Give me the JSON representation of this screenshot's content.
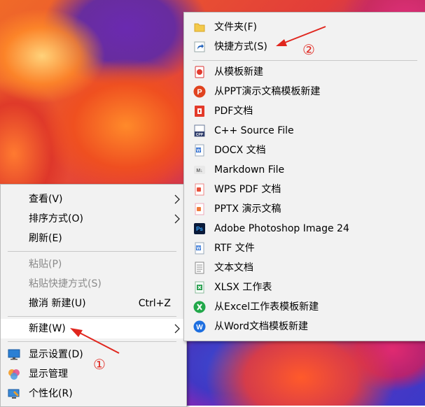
{
  "context_menu": {
    "items": [
      {
        "label": "查看(V)",
        "has_submenu": true
      },
      {
        "label": "排序方式(O)",
        "has_submenu": true
      },
      {
        "label": "刷新(E)"
      },
      {
        "label": "粘贴(P)",
        "disabled": true
      },
      {
        "label": "粘贴快捷方式(S)",
        "disabled": true
      },
      {
        "label": "撤消 新建(U)",
        "shortcut": "Ctrl+Z"
      },
      {
        "label": "新建(W)",
        "has_submenu": true,
        "highlighted": true
      },
      {
        "label": "显示设置(D)",
        "icon": "display-settings-icon"
      },
      {
        "label": "显示管理",
        "icon": "display-manager-icon"
      },
      {
        "label": "个性化(R)",
        "icon": "personalize-icon"
      }
    ]
  },
  "new_submenu": {
    "items": [
      {
        "label": "文件夹(F)",
        "icon": "folder-icon"
      },
      {
        "label": "快捷方式(S)",
        "icon": "shortcut-icon"
      },
      {
        "label": "从模板新建",
        "icon": "template-icon"
      },
      {
        "label": "从PPT演示文稿模板新建",
        "icon": "ppt-template-icon"
      },
      {
        "label": "PDF文档",
        "icon": "pdf-icon"
      },
      {
        "label": "C++ Source File",
        "icon": "cpp-file-icon"
      },
      {
        "label": "DOCX 文档",
        "icon": "docx-icon"
      },
      {
        "label": "Markdown File",
        "icon": "markdown-icon"
      },
      {
        "label": "WPS PDF 文档",
        "icon": "wps-pdf-icon"
      },
      {
        "label": "PPTX 演示文稿",
        "icon": "pptx-icon"
      },
      {
        "label": "Adobe Photoshop Image 24",
        "icon": "photoshop-icon"
      },
      {
        "label": "RTF 文件",
        "icon": "rtf-icon"
      },
      {
        "label": "文本文档",
        "icon": "text-document-icon"
      },
      {
        "label": "XLSX 工作表",
        "icon": "xlsx-icon"
      },
      {
        "label": "从Excel工作表模板新建",
        "icon": "excel-template-icon"
      },
      {
        "label": "从Word文档模板新建",
        "icon": "word-template-icon"
      }
    ]
  },
  "annotations": {
    "step1": "①",
    "step2": "②",
    "color": "#e0261e"
  }
}
